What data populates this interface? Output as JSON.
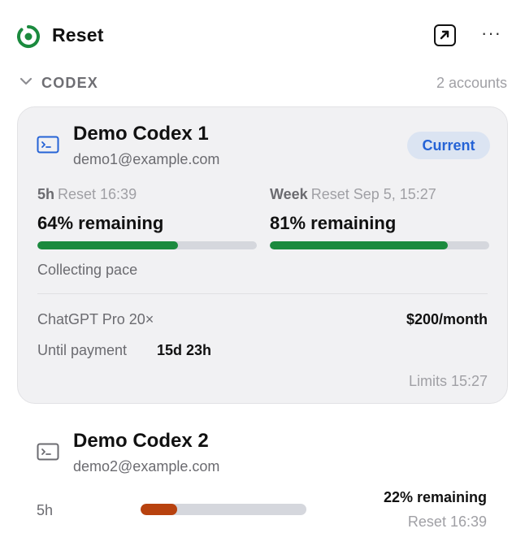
{
  "header": {
    "title": "Reset",
    "logo_icon": "reset-ring-logo",
    "popout_icon": "popout-arrow-icon",
    "more_icon": "ellipsis-icon",
    "more_glyph": "···",
    "accent": "#1b8a3e"
  },
  "section": {
    "title": "CODEX",
    "count": "2 accounts",
    "chevron_icon": "chevron-down-icon"
  },
  "accounts": [
    {
      "name": "Demo Codex 1",
      "email": "demo1@example.com",
      "badge": "Current",
      "windows": [
        {
          "label": "5h",
          "reset": "Reset 16:39",
          "remaining_text": "64% remaining",
          "remaining_fraction": 0.64,
          "color": "#1b8a3e"
        },
        {
          "label": "Week",
          "reset": "Reset Sep 5, 15:27",
          "remaining_text": "81% remaining",
          "remaining_fraction": 0.81,
          "color": "#1b8a3e"
        }
      ],
      "pace": "Collecting pace",
      "plan": "ChatGPT Pro 20×",
      "price": "$200/month",
      "until_label": "Until payment",
      "until_value": "15d 23h",
      "limits": "Limits 15:27"
    },
    {
      "name": "Demo Codex 2",
      "email": "demo2@example.com",
      "windows": [
        {
          "label": "5h",
          "reset": "Reset 16:39",
          "remaining_text": "22% remaining",
          "remaining_fraction": 0.22,
          "color": "#b8420f"
        }
      ]
    }
  ]
}
